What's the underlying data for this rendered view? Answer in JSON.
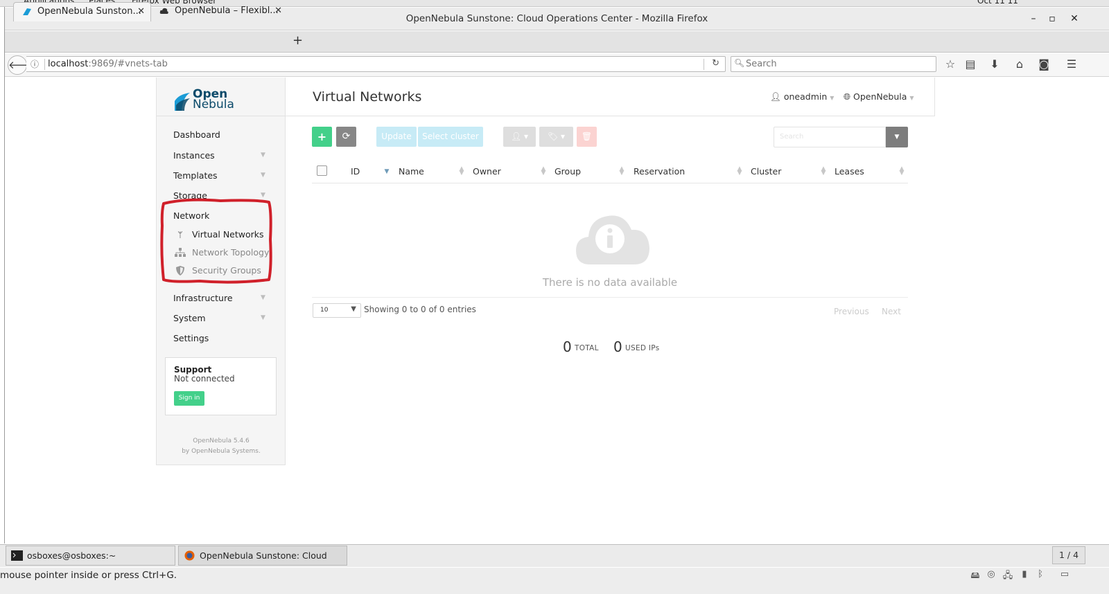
{
  "system_bar": {
    "left_items": [
      "Applications",
      "Places",
      "Firefox Web Browser"
    ],
    "clock": "Oct 11 11"
  },
  "window": {
    "title": "OpenNebula Sunstone: Cloud Operations Center - Mozilla Firefox",
    "minimize": "–",
    "maximize": "▫",
    "close": "✕"
  },
  "tabs": [
    {
      "label": "OpenNebula Sunston...",
      "close": "✕"
    },
    {
      "label": "OpenNebula – Flexibl...",
      "close": "✕"
    }
  ],
  "new_tab": "+",
  "nav": {
    "url_host": "localhost",
    "url_rest": ":9869/#vnets-tab",
    "search_placeholder": "Search"
  },
  "app": {
    "logo_line1": "Open",
    "logo_line2": "Nebula",
    "menu": [
      {
        "label": "Dashboard"
      },
      {
        "label": "Instances"
      },
      {
        "label": "Templates"
      },
      {
        "label": "Storage"
      },
      {
        "label": "Network"
      },
      {
        "label": "Infrastructure"
      },
      {
        "label": "System"
      },
      {
        "label": "Settings"
      }
    ],
    "network_submenu": [
      {
        "label": "Virtual Networks",
        "icon": "code-fork-icon",
        "active": true
      },
      {
        "label": "Network Topology",
        "icon": "sitemap-icon",
        "active": false
      },
      {
        "label": "Security Groups",
        "icon": "shield-icon",
        "active": false
      }
    ],
    "support": {
      "title": "Support",
      "status": "Not connected",
      "signin": "Sign in"
    },
    "version_line1": "OpenNebula 5.4.6",
    "version_line2": "by OpenNebula Systems."
  },
  "main": {
    "title": "Virtual Networks",
    "user": "oneadmin",
    "zone": "OpenNebula",
    "toolbar": {
      "add": "+",
      "refresh": "⟳",
      "update": "Update",
      "select_cluster": "Select cluster",
      "search_placeholder": "Search"
    },
    "columns": [
      "ID",
      "Name",
      "Owner",
      "Group",
      "Reservation",
      "Cluster",
      "Leases"
    ],
    "empty_text": "There is no data available",
    "page_size": "10",
    "showing": "Showing 0 to 0 of 0 entries",
    "previous": "Previous",
    "next": "Next",
    "stats": [
      {
        "value": "0",
        "label": "TOTAL"
      },
      {
        "value": "0",
        "label": "USED IPs"
      }
    ]
  },
  "taskbar": {
    "items": [
      "osboxes@osboxes:~",
      "OpenNebula Sunstone: Cloud Opera..."
    ],
    "workspace": "1 / 4"
  },
  "status": {
    "text": "mouse pointer inside or press Ctrl+G."
  },
  "colors": {
    "accent_green": "#43d08a",
    "annotation_red": "#d0202a",
    "brand_blue": "#1b9cd6"
  }
}
